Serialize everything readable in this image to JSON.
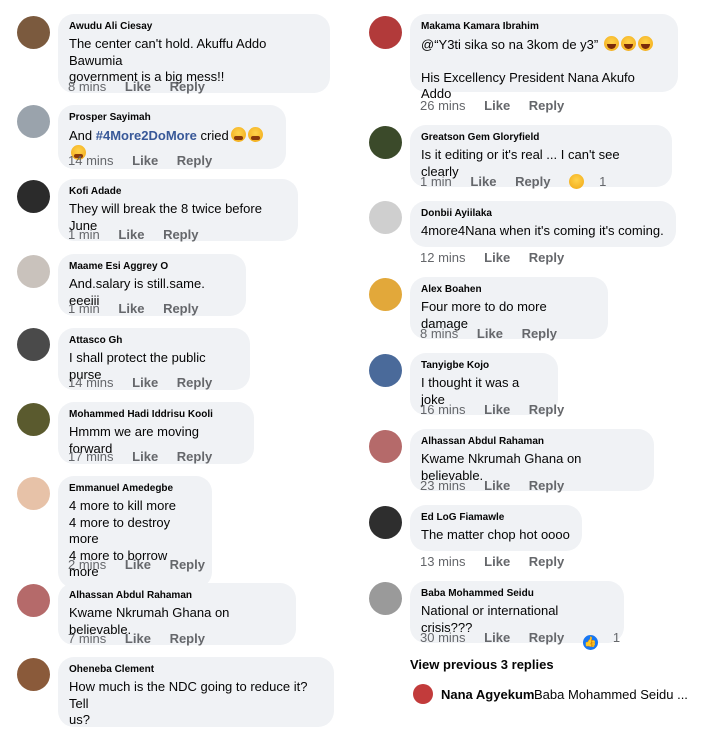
{
  "left_comments": [
    {
      "author": "Awudu Ali Ciesay",
      "lines": [
        "The center can't hold. Akuffu Addo Bawumia",
        "government is a big mess!!"
      ],
      "time": "8 mins",
      "like": "Like",
      "reply": "Reply"
    },
    {
      "author": "Prosper Sayimah",
      "lines": [
        "And "
      ],
      "hashtag": "#4More2DoMore",
      "suffix": " cried",
      "time": "14 mins",
      "like": "Like",
      "reply": "Reply"
    },
    {
      "author": "Kofi Adade",
      "lines": [
        "They will break the 8 twice before June"
      ],
      "time": "1 min",
      "like": "Like",
      "reply": "Reply"
    },
    {
      "author": "Maame Esi Aggrey O",
      "lines": [
        "And.salary is still.same. eeeiii"
      ],
      "time": "1 min",
      "like": "Like",
      "reply": "Reply"
    },
    {
      "author": "Attasco Gh",
      "lines": [
        "I shall protect the public purse"
      ],
      "time": "14 mins",
      "like": "Like",
      "reply": "Reply"
    },
    {
      "author": "Mohammed Hadi Iddrisu Kooli",
      "lines": [
        "Hmmm we are moving forward"
      ],
      "time": "17 mins",
      "like": "Like",
      "reply": "Reply"
    },
    {
      "author": "Emmanuel Amedegbe",
      "lines": [
        "4 more to kill more",
        "4 more to destroy more",
        "4 more to borrow more"
      ],
      "time": "2 mins",
      "like": "Like",
      "reply": "Reply"
    },
    {
      "author": "Alhassan Abdul Rahaman",
      "lines": [
        "Kwame Nkrumah Ghana on believable."
      ],
      "time": "7 mins",
      "like": "Like",
      "reply": "Reply"
    },
    {
      "author": "Oheneba Clement",
      "lines": [
        "How much is the NDC going to reduce it? Tell",
        "us?"
      ]
    }
  ],
  "right_comments": [
    {
      "author": "Makama Kamara Ibrahim",
      "lines": [
        "@“Y3ti sika so na 3kom de y3” ",
        "",
        "His Excellency President Nana Akufo Addo"
      ],
      "time": "26 mins",
      "like": "Like",
      "reply": "Reply"
    },
    {
      "author": "Greatson Gem Gloryfield",
      "lines": [
        "Is it editing or it's real ... I can't see clearly"
      ],
      "time": "1 min",
      "like": "Like",
      "reply": "Reply",
      "reaction_count": "1"
    },
    {
      "author": "Donbii Ayiilaka",
      "lines": [
        "4more4Nana when it's coming it's coming."
      ],
      "time": "12 mins",
      "like": "Like",
      "reply": "Reply"
    },
    {
      "author": "Alex Boahen",
      "lines": [
        "Four more to do more damage"
      ],
      "time": "8 mins",
      "like": "Like",
      "reply": "Reply"
    },
    {
      "author": "Tanyigbe Kojo",
      "lines": [
        "I thought it was a joke"
      ],
      "time": "16 mins",
      "like": "Like",
      "reply": "Reply"
    },
    {
      "author": "Alhassan Abdul Rahaman",
      "lines": [
        "Kwame Nkrumah Ghana on believable."
      ],
      "time": "23 mins",
      "like": "Like",
      "reply": "Reply"
    },
    {
      "author": "Ed LoG Fiamawle",
      "lines": [
        "The matter chop hot oooo"
      ],
      "time": "13 mins",
      "like": "Like",
      "reply": "Reply"
    },
    {
      "author": "Baba Mohammed Seidu",
      "lines": [
        "National or international crisis???"
      ],
      "time": "30 mins",
      "like": "Like",
      "reply": "Reply",
      "reaction_count": "1"
    }
  ],
  "view_previous": "View previous 3 replies",
  "reply_preview": {
    "author": "Nana Agyekum",
    "text": "Baba Mohammed Seidu ..."
  }
}
